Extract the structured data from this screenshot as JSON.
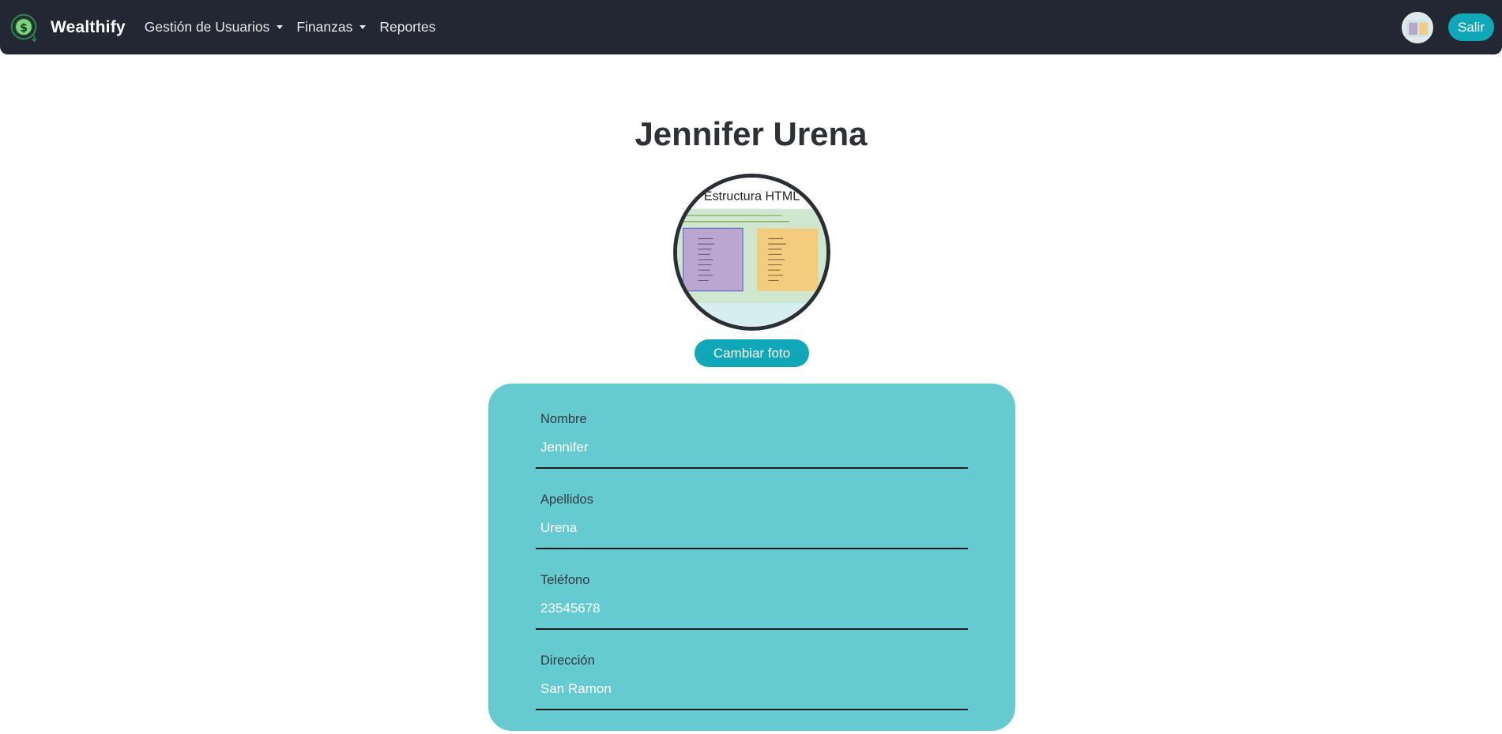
{
  "navbar": {
    "brand": "Wealthify",
    "links": [
      {
        "label": "Gestión de Usuarios",
        "dropdown": true
      },
      {
        "label": "Finanzas",
        "dropdown": true
      },
      {
        "label": "Reportes",
        "dropdown": false
      }
    ],
    "logout_label": "Salir"
  },
  "profile": {
    "name": "Jennifer Urena",
    "photo_text": "Estructura HTML",
    "change_photo_label": "Cambiar foto"
  },
  "form": {
    "fields": [
      {
        "label": "Nombre",
        "value": "Jennifer"
      },
      {
        "label": "Apellidos",
        "value": "Urena"
      },
      {
        "label": "Teléfono",
        "value": "23545678"
      },
      {
        "label": "Dirección",
        "value": "San Ramon"
      }
    ]
  },
  "colors": {
    "navbar_bg": "#232733",
    "accent": "#10a7b8",
    "card_bg": "#66cbd0",
    "title_text": "#2d3034"
  },
  "icons": {
    "brand": "dollar-coin-icon",
    "dropdown": "caret-down-icon"
  }
}
